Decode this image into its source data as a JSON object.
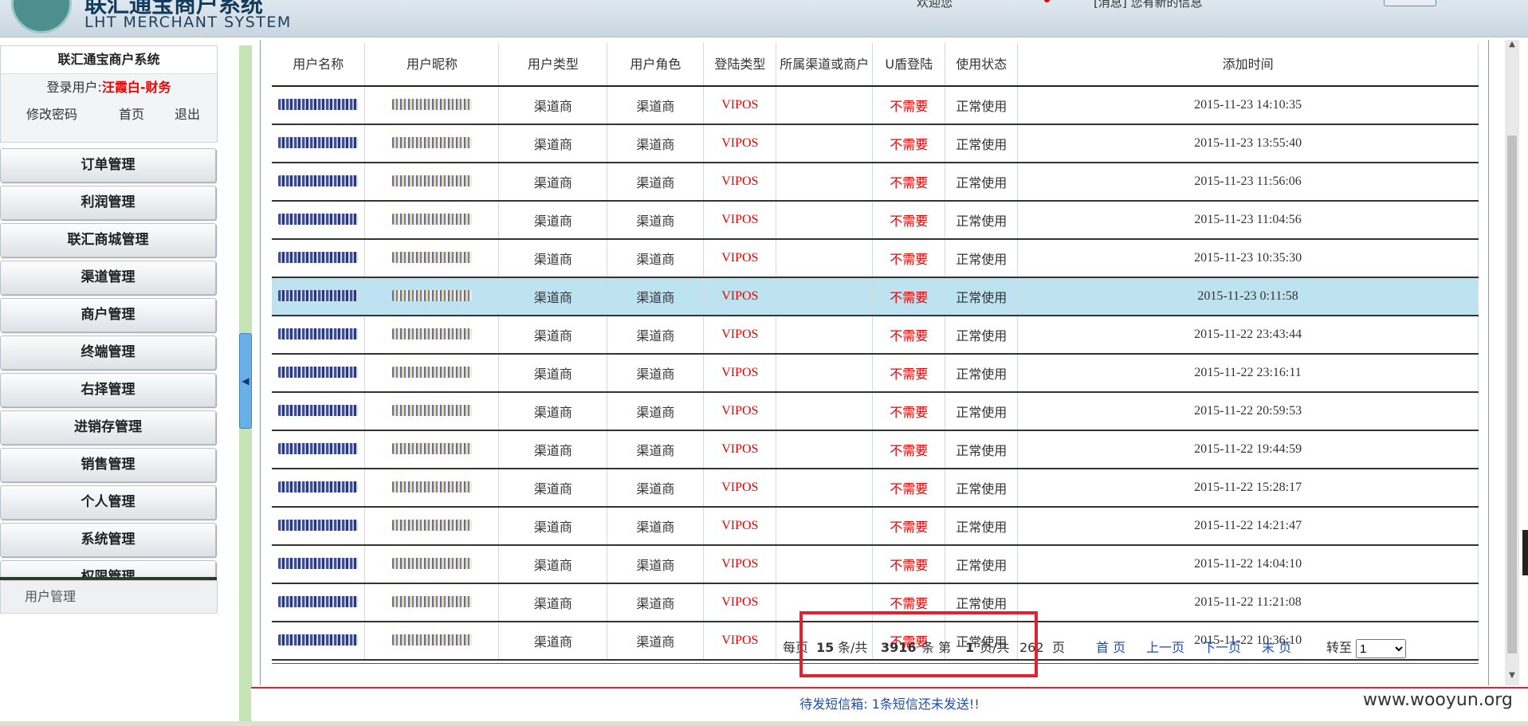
{
  "header": {
    "title_cn": "联汇通宝商户系统",
    "title_en": "LHT MERCHANT SYSTEM",
    "info": "欢迎您",
    "notice": "[消息] 您有新的信息"
  },
  "sidebar": {
    "system_title": "联汇通宝商户系统",
    "login_label": "登录用户:",
    "login_user": "汪霞白-财务",
    "change_password": "修改密码",
    "home": "首页",
    "logout": "退出",
    "menu": [
      "订单管理",
      "利润管理",
      "联汇商城管理",
      "渠道管理",
      "商户管理",
      "终端管理",
      "右择管理",
      "进销存管理",
      "销售管理",
      "个人管理",
      "系统管理",
      "权限管理"
    ],
    "submenu": "用户管理"
  },
  "table": {
    "columns": [
      "用户名称",
      "用户昵称",
      "用户类型",
      "用户角色",
      "登陆类型",
      "所属渠道或商户",
      "U盾登陆",
      "使用状态",
      "添加时间"
    ],
    "rows": [
      {
        "type": "渠道商",
        "role": "渠道商",
        "login": "VIPOS",
        "owner": "",
        "ukey": "不需要",
        "status": "正常使用",
        "time": "2015-11-23 14:10:35"
      },
      {
        "type": "渠道商",
        "role": "渠道商",
        "login": "VIPOS",
        "owner": "",
        "ukey": "不需要",
        "status": "正常使用",
        "time": "2015-11-23 13:55:40"
      },
      {
        "type": "渠道商",
        "role": "渠道商",
        "login": "VIPOS",
        "owner": "",
        "ukey": "不需要",
        "status": "正常使用",
        "time": "2015-11-23 11:56:06"
      },
      {
        "type": "渠道商",
        "role": "渠道商",
        "login": "VIPOS",
        "owner": "",
        "ukey": "不需要",
        "status": "正常使用",
        "time": "2015-11-23 11:04:56"
      },
      {
        "type": "渠道商",
        "role": "渠道商",
        "login": "VIPOS",
        "owner": "",
        "ukey": "不需要",
        "status": "正常使用",
        "time": "2015-11-23 10:35:30"
      },
      {
        "type": "渠道商",
        "role": "渠道商",
        "login": "VIPOS",
        "owner": "",
        "ukey": "不需要",
        "status": "正常使用",
        "time": "2015-11-23 0:11:58"
      },
      {
        "type": "渠道商",
        "role": "渠道商",
        "login": "VIPOS",
        "owner": "",
        "ukey": "不需要",
        "status": "正常使用",
        "time": "2015-11-22 23:43:44"
      },
      {
        "type": "渠道商",
        "role": "渠道商",
        "login": "VIPOS",
        "owner": "",
        "ukey": "不需要",
        "status": "正常使用",
        "time": "2015-11-22 23:16:11"
      },
      {
        "type": "渠道商",
        "role": "渠道商",
        "login": "VIPOS",
        "owner": "",
        "ukey": "不需要",
        "status": "正常使用",
        "time": "2015-11-22 20:59:53"
      },
      {
        "type": "渠道商",
        "role": "渠道商",
        "login": "VIPOS",
        "owner": "",
        "ukey": "不需要",
        "status": "正常使用",
        "time": "2015-11-22 19:44:59"
      },
      {
        "type": "渠道商",
        "role": "渠道商",
        "login": "VIPOS",
        "owner": "",
        "ukey": "不需要",
        "status": "正常使用",
        "time": "2015-11-22 15:28:17"
      },
      {
        "type": "渠道商",
        "role": "渠道商",
        "login": "VIPOS",
        "owner": "",
        "ukey": "不需要",
        "status": "正常使用",
        "time": "2015-11-22 14:21:47"
      },
      {
        "type": "渠道商",
        "role": "渠道商",
        "login": "VIPOS",
        "owner": "",
        "ukey": "不需要",
        "status": "正常使用",
        "time": "2015-11-22 14:04:10"
      },
      {
        "type": "渠道商",
        "role": "渠道商",
        "login": "VIPOS",
        "owner": "",
        "ukey": "不需要",
        "status": "正常使用",
        "time": "2015-11-22 11:21:08"
      },
      {
        "type": "渠道商",
        "role": "渠道商",
        "login": "VIPOS",
        "owner": "",
        "ukey": "不需要",
        "status": "正常使用",
        "time": "2015-11-22 10:36:10"
      }
    ],
    "selected_row": 5
  },
  "pager": {
    "per_page_label": "每页",
    "per_page": "15",
    "total_label_a": "条/共",
    "total": "3916",
    "total_label_b": "条 第",
    "current": "1",
    "pages_label": "页/共",
    "pages": "262",
    "pages_suffix": "页",
    "first": "首 页",
    "prev": "上一页",
    "next": "下一页",
    "last": "末 页",
    "goto": "转至",
    "goto_value": "1"
  },
  "footer": {
    "message": "待发短信箱: 1条短信还未发送!!",
    "watermark": "www.wooyun.org"
  },
  "colors": {
    "accent_red": "#e00000",
    "selected_row": "#bde3f1",
    "link_blue": "#1d4fb1",
    "highlight_box": "#e0212e"
  }
}
